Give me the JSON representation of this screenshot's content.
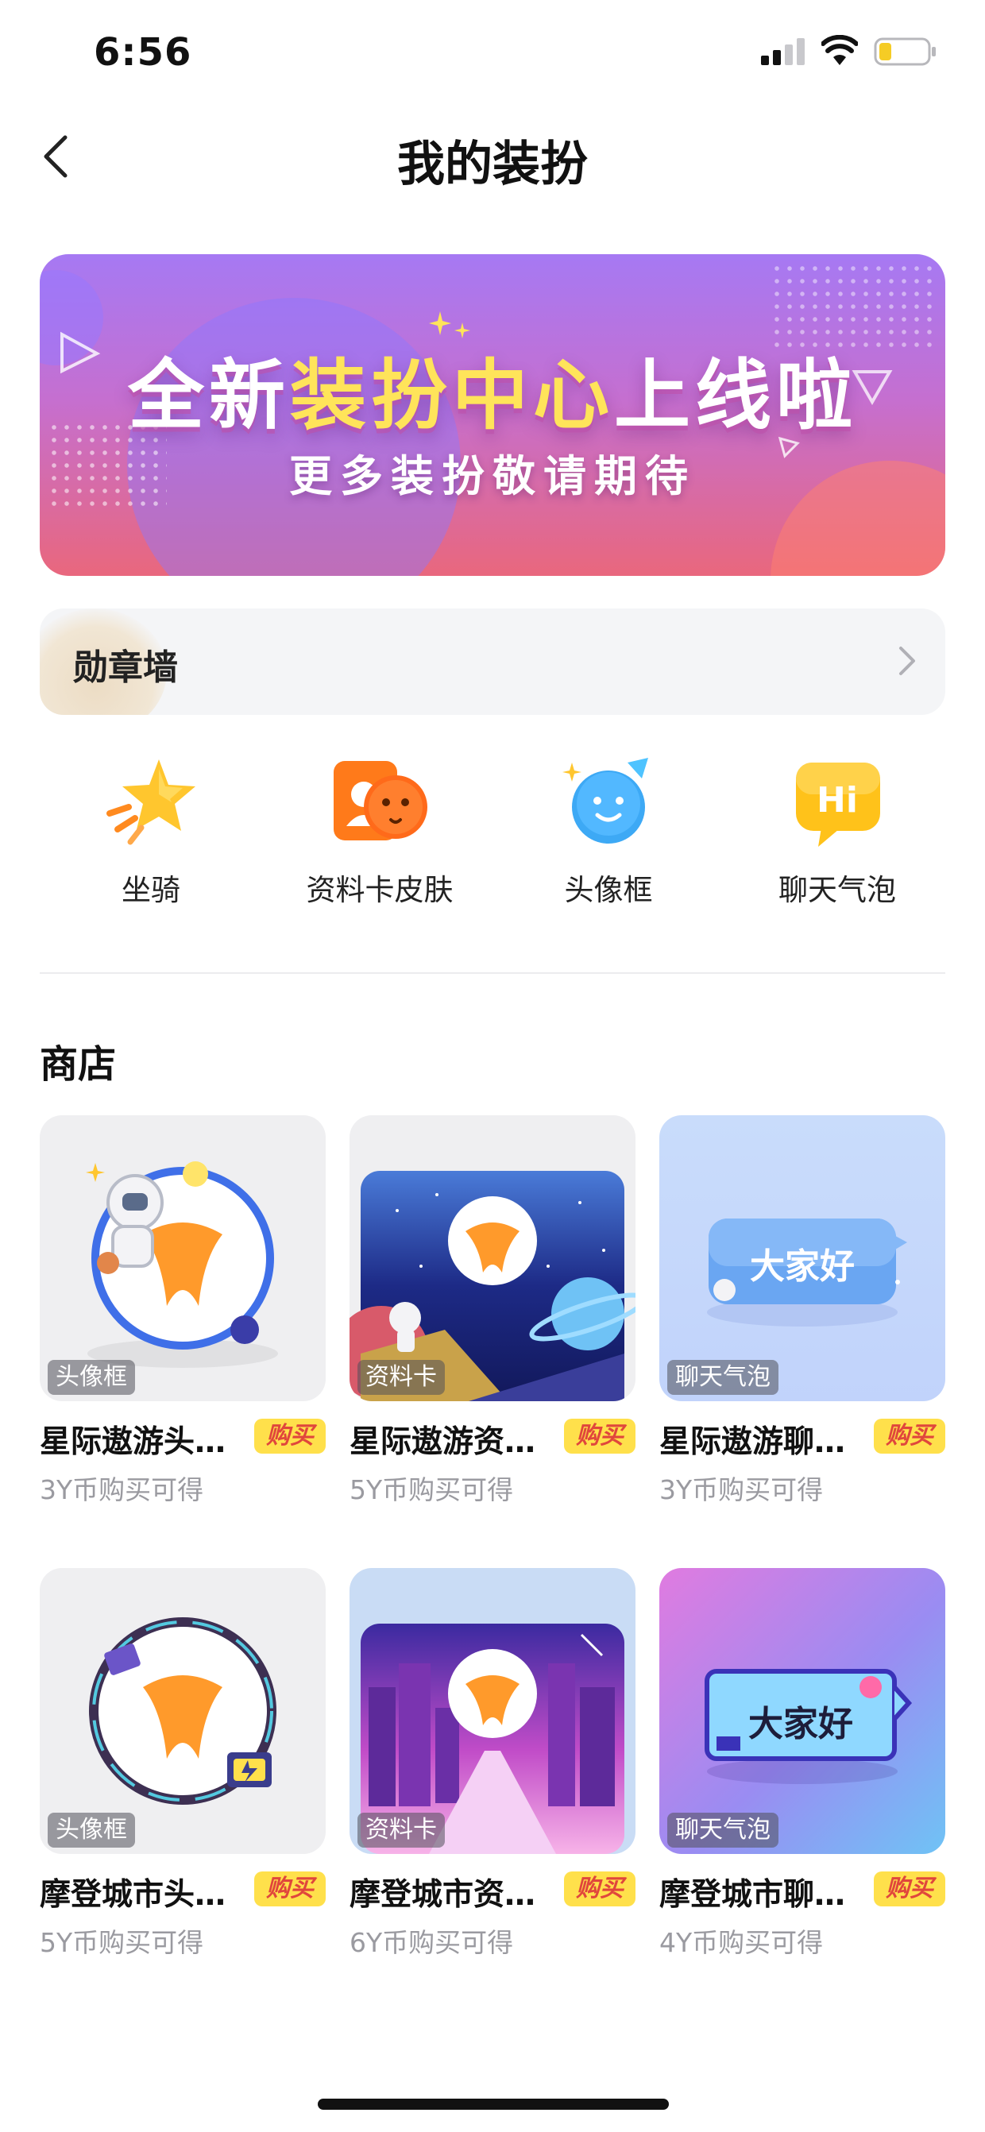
{
  "status_bar": {
    "time": "6:56"
  },
  "nav": {
    "title": "我的装扮"
  },
  "banner": {
    "headline_part1": "全新",
    "headline_highlight": "装扮中心",
    "headline_part2": "上线啦",
    "subline": "更多装扮敬请期待"
  },
  "medal_wall": {
    "label": "勋章墙"
  },
  "categories": [
    {
      "label": "坐骑",
      "icon": "star-mount-icon"
    },
    {
      "label": "资料卡皮肤",
      "icon": "profile-card-skin-icon"
    },
    {
      "label": "头像框",
      "icon": "avatar-frame-icon"
    },
    {
      "label": "聊天气泡",
      "icon": "chat-bubble-icon"
    }
  ],
  "shop": {
    "title": "商店",
    "buy_label": "购买",
    "items": [
      {
        "name": "星际遨游头像框",
        "tag": "头像框",
        "price": "3Y币购买可得"
      },
      {
        "name": "星际遨游资料卡",
        "tag": "资料卡",
        "price": "5Y币购买可得"
      },
      {
        "name": "星际遨游聊天气泡",
        "tag": "聊天气泡",
        "price": "3Y币购买可得",
        "bubble_text": "大家好"
      },
      {
        "name": "摩登城市头像框",
        "tag": "头像框",
        "price": "5Y币购买可得"
      },
      {
        "name": "摩登城市资料卡",
        "tag": "资料卡",
        "price": "6Y币购买可得"
      },
      {
        "name": "摩登城市聊天气泡",
        "tag": "聊天气泡",
        "price": "4Y币购买可得",
        "bubble_text": "大家好"
      }
    ]
  },
  "colors": {
    "accent_yellow": "#ffe04b",
    "buy_text": "#e0463c",
    "banner_top": "#a679f3",
    "banner_bottom": "#e9677d"
  }
}
